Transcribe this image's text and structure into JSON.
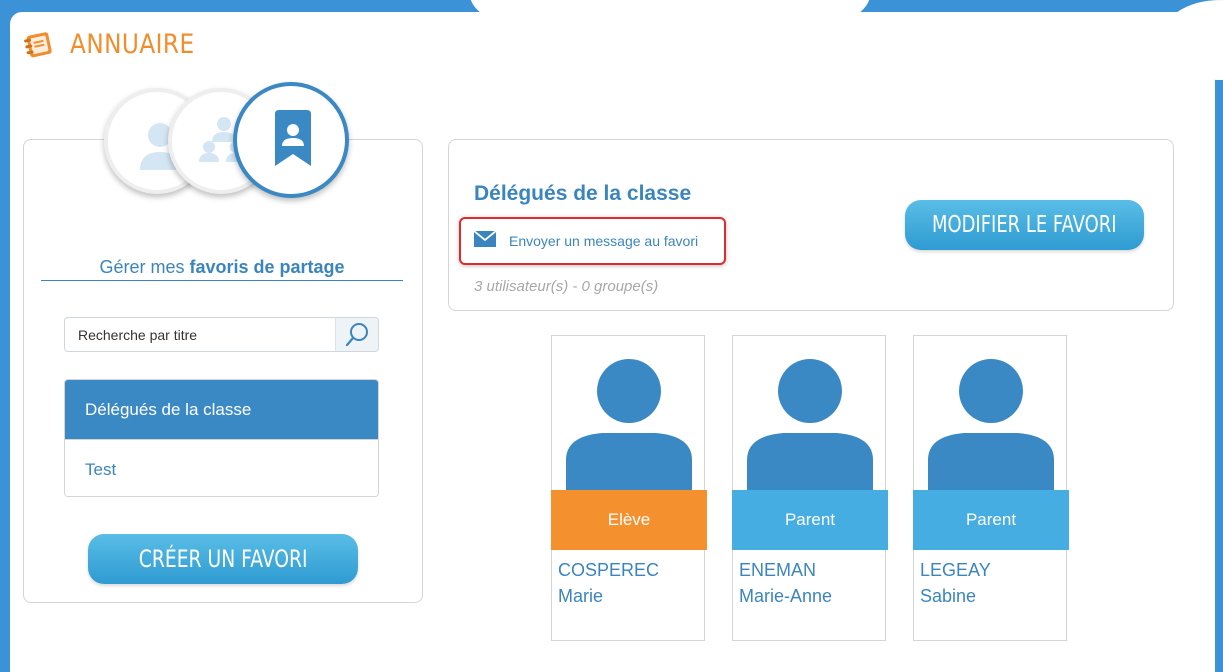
{
  "app": {
    "title": "ANNUAIRE",
    "logo_icon": "notebook-icon"
  },
  "colors": {
    "accent": "#3a89c4",
    "orange": "#f28d2c",
    "student": "#f5902f",
    "parent": "#45ade1",
    "highlight": "#e12a2a"
  },
  "tabs": [
    {
      "name": "users",
      "icon": "user-icon",
      "active": false
    },
    {
      "name": "groups",
      "icon": "group-icon",
      "active": false
    },
    {
      "name": "favorites",
      "icon": "bookmark-user-icon",
      "active": true
    }
  ],
  "sidebar": {
    "title_prefix": "Gérer mes",
    "title_bold": "favoris de partage",
    "search": {
      "placeholder": "Recherche par titre",
      "icon": "search-icon"
    },
    "favorites": [
      {
        "label": "Délégués de la classe",
        "selected": true
      },
      {
        "label": "Test",
        "selected": false
      }
    ],
    "create_button": "CRÉER UN FAVORI"
  },
  "detail": {
    "title": "Délégués de la classe",
    "message_link": "Envoyer un message au favori",
    "message_icon": "envelope-icon",
    "counts": "3 utilisateur(s) - 0 groupe(s)",
    "modify_button": "MODIFIER LE FAVORI"
  },
  "members": [
    {
      "role": "Elève",
      "last_name": "COSPEREC",
      "first_name": "Marie"
    },
    {
      "role": "Parent",
      "last_name": "ENEMAN",
      "first_name": "Marie-Anne"
    },
    {
      "role": "Parent",
      "last_name": "LEGEAY",
      "first_name": "Sabine"
    }
  ]
}
